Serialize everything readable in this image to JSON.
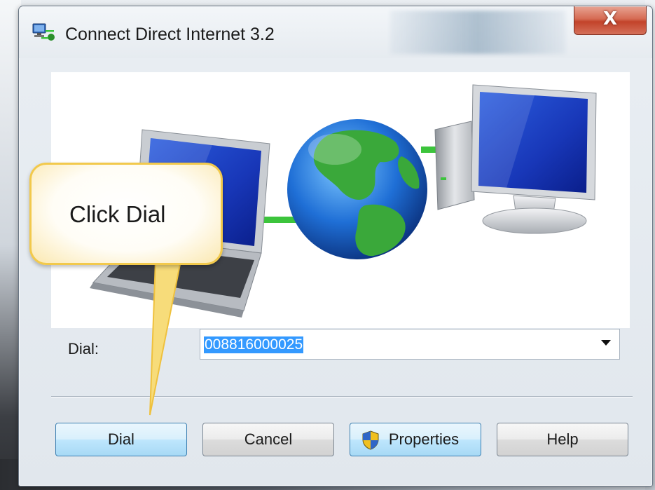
{
  "window": {
    "title": "Connect Direct Internet 3.2",
    "close_label": "X"
  },
  "dial": {
    "label": "Dial:",
    "value": "008816000025"
  },
  "buttons": {
    "dial": "Dial",
    "cancel": "Cancel",
    "properties": "Properties",
    "help": "Help"
  },
  "callout": {
    "text": "Click Dial"
  },
  "icons": [
    "network-connection-icon",
    "close-icon",
    "laptop-icon",
    "globe-icon",
    "desktop-computer-icon",
    "dropdown-arrow-icon",
    "uac-shield-icon"
  ],
  "colors": {
    "selection": "#3399ff",
    "close_button": "#c2432a",
    "callout_border": "#f2c94c",
    "network_line": "#3cc43c"
  }
}
